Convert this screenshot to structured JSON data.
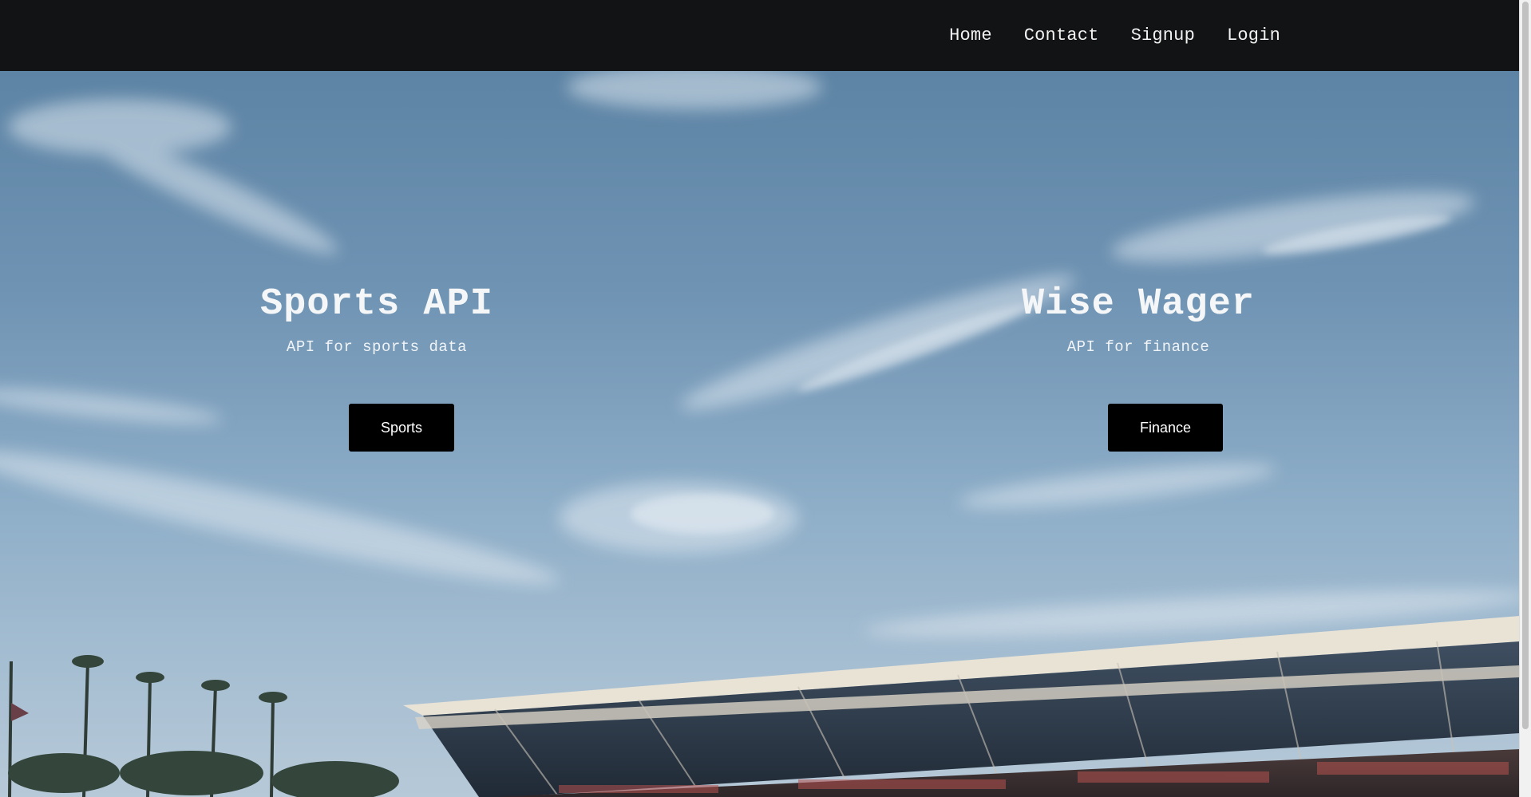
{
  "nav": {
    "items": [
      {
        "label": "Home"
      },
      {
        "label": "Contact"
      },
      {
        "label": "Signup"
      },
      {
        "label": "Login"
      }
    ]
  },
  "hero": {
    "background": "stadium-sky-photo",
    "features": [
      {
        "title": "Sports API",
        "subtitle": "API for sports data",
        "button_label": "Sports"
      },
      {
        "title": "Wise Wager",
        "subtitle": "API for finance",
        "button_label": "Finance"
      }
    ]
  },
  "colors": {
    "navbar": "#121315",
    "nav_text": "#f2f2f2",
    "button_bg": "#000000",
    "button_text": "#ffffff",
    "sky": "#6e93b2"
  }
}
